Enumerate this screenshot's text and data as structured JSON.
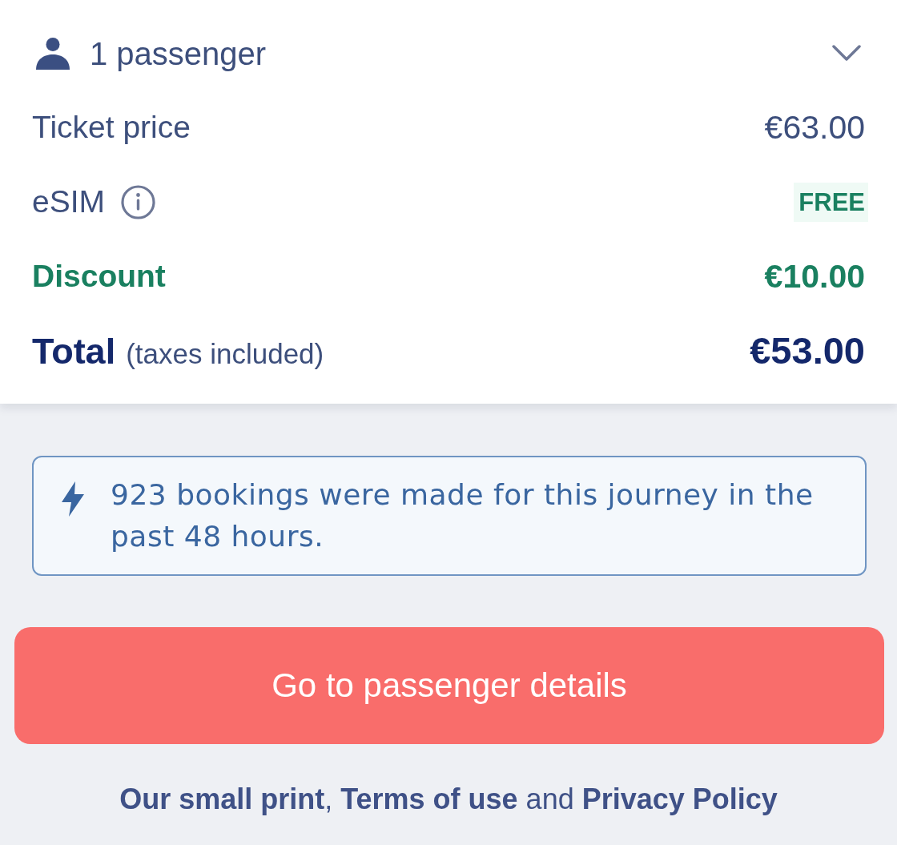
{
  "passengers": {
    "label": "1 passenger",
    "expanded": false
  },
  "price_rows": [
    {
      "kind": "plain",
      "label": "Ticket price",
      "value": "€63.00"
    },
    {
      "kind": "info",
      "label": "eSIM",
      "value": "FREE"
    },
    {
      "kind": "discount",
      "label": "Discount",
      "value": "€10.00"
    },
    {
      "kind": "total",
      "label": "Total",
      "note": "(taxes included)",
      "value": "€53.00"
    }
  ],
  "notice": {
    "text": "923 bookings were made for this journey in the past 48 hours."
  },
  "primary_button": {
    "label": "Go to passenger details"
  },
  "legal": [
    {
      "kind": "link",
      "text": "Our small print"
    },
    {
      "kind": "text",
      "text": ", "
    },
    {
      "kind": "link",
      "text": "Terms of use"
    },
    {
      "kind": "text",
      "text": " and "
    },
    {
      "kind": "link",
      "text": "Privacy Policy"
    }
  ]
}
